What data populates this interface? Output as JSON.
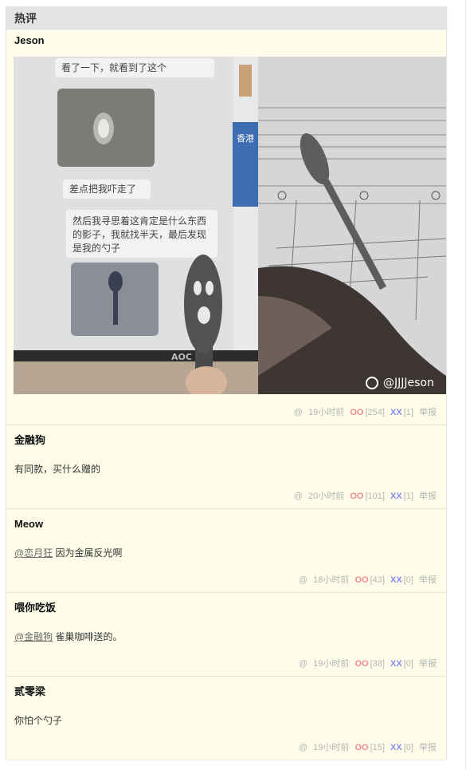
{
  "section_title": "热评",
  "comments": [
    {
      "author": "Jeson",
      "mention": "",
      "text": "",
      "time": "19小时前",
      "oo": "254",
      "xx": "1",
      "report": "举报"
    },
    {
      "author": "金融狗",
      "mention": "",
      "text": "有同款，买什么赠的",
      "time": "20小时前",
      "oo": "101",
      "xx": "1",
      "report": "举报"
    },
    {
      "author": "Meow",
      "mention": "@恋月狂",
      "text": " 因为金属反光啊",
      "time": "18小时前",
      "oo": "43",
      "xx": "0",
      "report": "举报"
    },
    {
      "author": "喂你吃饭",
      "mention": "@金融狗",
      "text": " 雀巢咖啡送的。",
      "time": "19小时前",
      "oo": "38",
      "xx": "0",
      "report": "举报"
    },
    {
      "author": "贰零梁",
      "mention": "",
      "text": "你怕个勺子",
      "time": "19小时前",
      "oo": "15",
      "xx": "0",
      "report": "举报"
    }
  ],
  "meta_labels": {
    "at": "@",
    "oo": "OO",
    "xx": "XX"
  },
  "photo": {
    "chat_lines": [
      "看了一下，就看到了这个",
      "差点把我吓走了",
      "然后我寻思着这肯定是什么东西",
      "的影子，我就找半天，最后发现",
      "是我的勺子"
    ],
    "monitor_brand": "AOC",
    "side_label": "香港",
    "watermark": "@JJJJeson"
  }
}
